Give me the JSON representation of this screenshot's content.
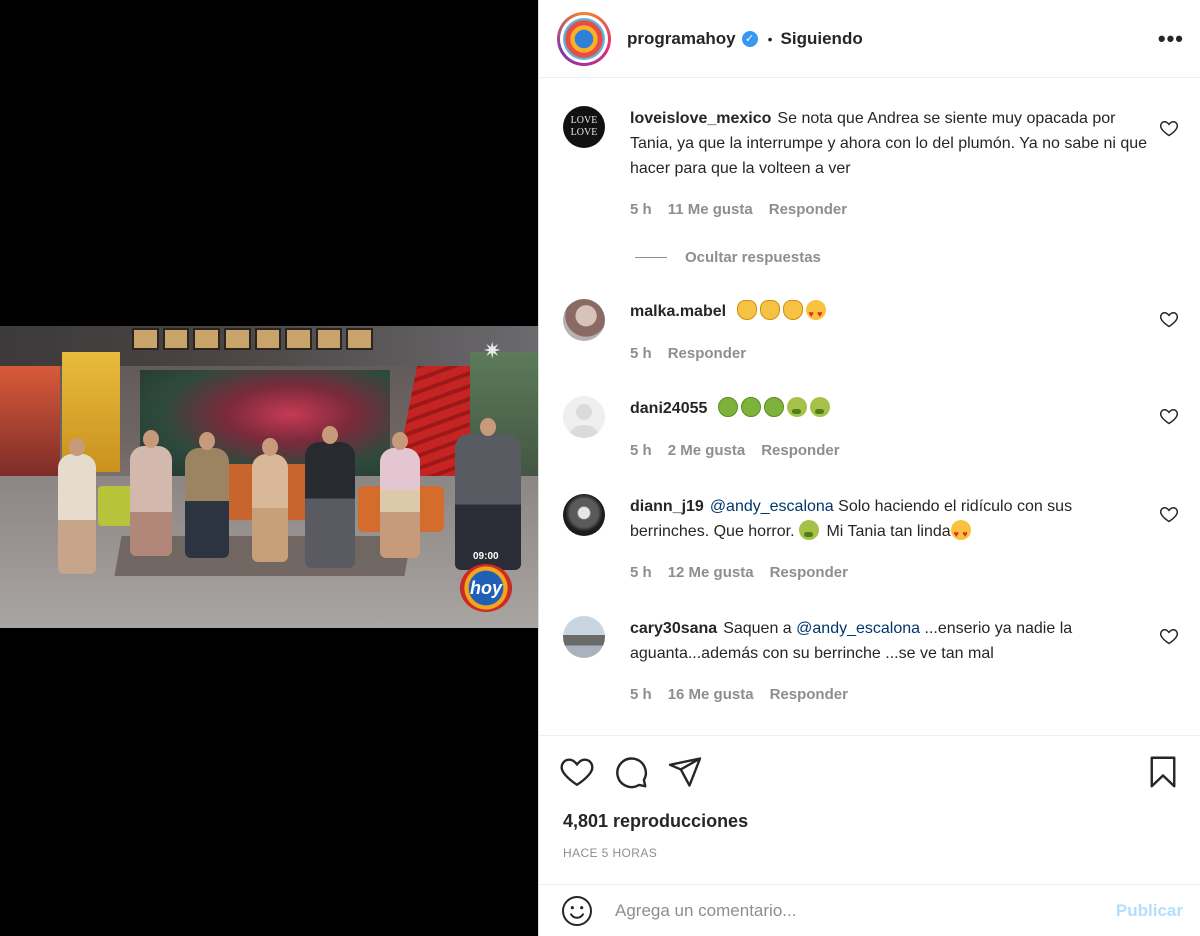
{
  "post": {
    "username": "programahoy",
    "verified": true,
    "separator": "•",
    "follow_state": "Siguiendo",
    "more_label": "•••"
  },
  "video": {
    "clock": "09:00",
    "logo_text": "hoy"
  },
  "comments": [
    {
      "username": "loveislove_mexico",
      "text": "Se nota que Andrea se siente muy opacada por Tania, ya que la interrumpe y ahora con lo del plumón. Ya no sabe ni que hacer para que la volteen a ver",
      "time": "5 h",
      "likes": "11 Me gusta",
      "reply": "Responder",
      "avatar_text": "LOVE LOVE"
    },
    {
      "username": "malka.mabel",
      "text": "",
      "emojis": [
        "clap",
        "clap",
        "clap",
        "heart-eyes"
      ],
      "time": "5 h",
      "reply": "Responder"
    },
    {
      "username": "dani24055",
      "text": "",
      "emojis": [
        "sick",
        "sick",
        "sick",
        "nauseated",
        "nauseated"
      ],
      "time": "5 h",
      "likes": "2 Me gusta",
      "reply": "Responder"
    },
    {
      "username": "diann_j19",
      "mention": "@andy_escalona",
      "text_a": "Solo haciendo el ridículo con sus berrinches. Que horror.",
      "text_b": "Mi Tania tan linda",
      "time": "5 h",
      "likes": "12 Me gusta",
      "reply": "Responder"
    },
    {
      "username": "cary30sana",
      "text_a": "Saquen a",
      "mention": "@andy_escalona",
      "text_b": "...enserio ya nadie la aguanta...además con su berrinche ...se ve tan mal",
      "time": "5 h",
      "likes": "16 Me gusta",
      "reply": "Responder"
    }
  ],
  "hide_replies": "Ocultar respuestas",
  "stats": {
    "views": "4,801 reproducciones",
    "time_ago": "HACE 5 HORAS"
  },
  "composer": {
    "placeholder": "Agrega un comentario...",
    "publish": "Publicar"
  },
  "colors": {
    "text": "#262626",
    "muted": "#8e8e8e",
    "link": "#00376b",
    "verified": "#3897f0",
    "publish_disabled": "#b2dffc"
  }
}
